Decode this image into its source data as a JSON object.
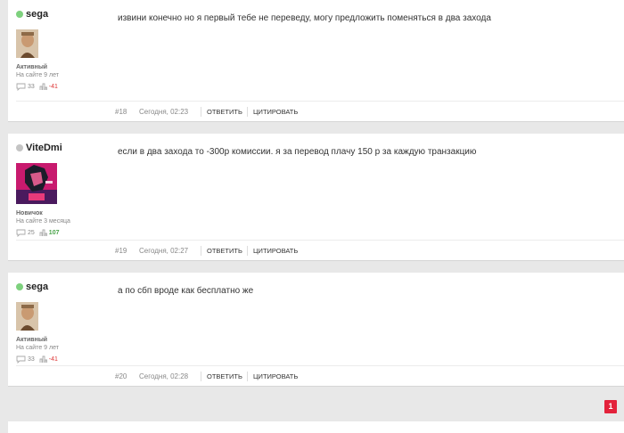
{
  "posts": [
    {
      "author": "sega",
      "status": "online",
      "rank": "Активный",
      "since": "На сайте 9 лет",
      "messages": "33",
      "reputation": "-41",
      "text": "извини конечно но я первый тебе не переведу, могу предложить поменяться в два захода",
      "number": "#18",
      "time": "Сегодня, 02:23",
      "reply": "ОТВЕТИТЬ",
      "quote": "ЦИТИРОВАТЬ"
    },
    {
      "author": "ViteDmi",
      "status": "offline",
      "rank": "Новичок",
      "since": "На сайте 3 месяца",
      "messages": "25",
      "reputation": "107",
      "text": "если в два захода то -300р  комиссии.  я за перевод плачу 150 р за каждую транзакцию",
      "number": "#19",
      "time": "Сегодня, 02:27",
      "reply": "ОТВЕТИТЬ",
      "quote": "ЦИТИРОВАТЬ"
    },
    {
      "author": "sega",
      "status": "online",
      "rank": "Активный",
      "since": "На сайте 9 лет",
      "messages": "33",
      "reputation": "-41",
      "text": "а по сбп вроде как бесплатно же",
      "number": "#20",
      "time": "Сегодня, 02:28",
      "reply": "ОТВЕТИТЬ",
      "quote": "ЦИТИРОВАТЬ"
    }
  ],
  "pagination": {
    "current": "1"
  },
  "colors": {
    "accent": "#e3223b",
    "online": "#7ed17e",
    "negative": "#dd3333",
    "positive": "#49a349"
  }
}
